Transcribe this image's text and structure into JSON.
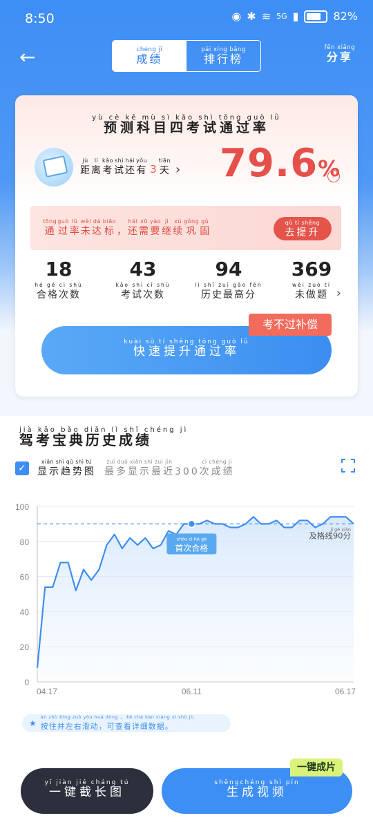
{
  "status": {
    "time": "8:50",
    "network": "5G",
    "battery": "82%"
  },
  "header": {
    "tabs": [
      {
        "py": "chéng jì",
        "hz": "成绩",
        "active": true
      },
      {
        "py": "pái xíng bǎng",
        "hz": "排行榜",
        "active": false
      }
    ],
    "share": {
      "py": "fēn xiǎng",
      "hz": "分享"
    }
  },
  "card": {
    "title": {
      "py": "yù cè kē mù sì kǎo shì tōng guò lǜ",
      "hz": "预测科目四考试通过率"
    },
    "remain": {
      "chars": [
        {
          "py": "jù",
          "hz": "距"
        },
        {
          "py": "lí",
          "hz": "离"
        },
        {
          "py": "kǎo",
          "hz": "考"
        },
        {
          "py": "shì",
          "hz": "试"
        },
        {
          "py": "hái",
          "hz": "还"
        },
        {
          "py": "yǒu",
          "hz": "有"
        }
      ],
      "days": "3",
      "unit": {
        "py": "tiān",
        "hz": "天"
      }
    },
    "pass_rate": "79.6",
    "pass_rate_unit": "%",
    "warning": {
      "chars": [
        {
          "py": "tōng",
          "hz": "通"
        },
        {
          "py": "guò",
          "hz": "过"
        },
        {
          "py": "lǜ",
          "hz": "率"
        },
        {
          "py": "wèi",
          "hz": "未"
        },
        {
          "py": "dá",
          "hz": "达"
        },
        {
          "py": "biāo",
          "hz": "标"
        },
        {
          "py": "",
          "hz": "，"
        },
        {
          "py": "hái",
          "hz": "还"
        },
        {
          "py": "xū",
          "hz": "需"
        },
        {
          "py": "yào",
          "hz": "要"
        },
        {
          "py": "jì",
          "hz": "继"
        },
        {
          "py": "xù",
          "hz": "续"
        },
        {
          "py": "gǒng",
          "hz": "巩"
        },
        {
          "py": "gù",
          "hz": "固"
        }
      ]
    },
    "improve_btn": {
      "py": "qù tí shēng",
      "hz": "去提升"
    },
    "stats": [
      {
        "value": "18",
        "py": "hé gé cì shù",
        "hz": "合格次数"
      },
      {
        "value": "43",
        "py": "kǎo shì cì shù",
        "hz": "考试次数"
      },
      {
        "value": "94",
        "py": "lì shǐ zuì gāo fēn",
        "hz": "历史最高分"
      },
      {
        "value": "369",
        "py": "wèi zuò tí",
        "hz": "未做题"
      }
    ],
    "badge": "考不过补偿",
    "fast_btn": {
      "py": "kuài sù tí shēng tōng guò lǜ",
      "hz": "快速提升通过率"
    }
  },
  "history": {
    "title": {
      "py": "jià kǎo bǎo diǎn lì shǐ chéng jì",
      "hz": "驾考宝典历史成绩"
    },
    "show_trend": {
      "py": "xiǎn shì qū shì tú",
      "hz": "显示趋势图"
    },
    "recent": {
      "py": "zuì duō xiǎn shì zuì jìn",
      "hz": "最多显示最近",
      "count": "300",
      "py2": "cì chéng jì",
      "hz2": "次成绩"
    },
    "hint": {
      "py": "àn zhù bìng zuǒ yòu huá dòng ， kě chá kàn xiáng xì shù jù",
      "hz": "按住并左右滑动，可查看详细数据。"
    }
  },
  "chart_data": {
    "type": "line",
    "ylim": [
      0,
      100
    ],
    "yticks": [
      "0",
      "20",
      "40",
      "60",
      "80",
      "100"
    ],
    "xticks": [
      "04.17",
      "06.11",
      "06.17"
    ],
    "pass_line": {
      "value": 90,
      "label_py": "jí gé xiàn",
      "label_hz": "及格线",
      "label_val": "90分"
    },
    "first_pass": {
      "index": 20,
      "label_py": "shǒu cì hé gé",
      "label_hz": "首次合格"
    },
    "values": [
      8,
      54,
      54,
      68,
      68,
      52,
      64,
      58,
      64,
      78,
      84,
      76,
      82,
      78,
      82,
      76,
      78,
      86,
      84,
      90,
      90,
      90,
      92,
      90,
      90,
      88,
      88,
      90,
      94,
      90,
      90,
      92,
      88,
      88,
      92,
      92,
      88,
      90,
      94,
      94,
      94,
      90
    ]
  },
  "bottom": {
    "screenshot": {
      "py": "yī jiàn jié cháng tú",
      "hz": "一键截长图"
    },
    "video": {
      "py": "shēngchéng shì pín",
      "hz": "生成视频"
    },
    "video_tag": "一键成片"
  }
}
